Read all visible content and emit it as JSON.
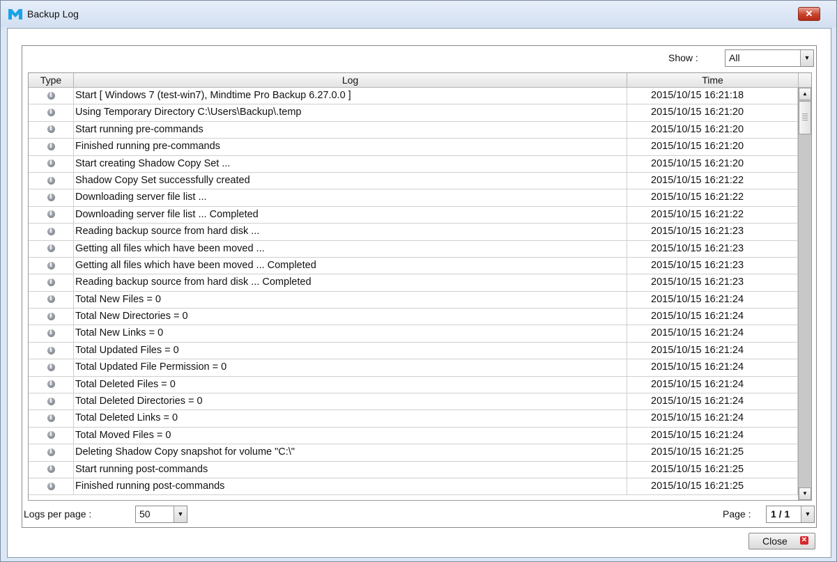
{
  "window": {
    "title": "Backup Log",
    "close_glyph": "✕",
    "logo_icon": "app-logo-icon"
  },
  "filter": {
    "show_label": "Show :",
    "show_value": "All"
  },
  "table": {
    "headers": {
      "type": "Type",
      "log": "Log",
      "time": "Time"
    },
    "rows": [
      {
        "type_icon": "info-icon",
        "log": "Start [ Windows 7 (test-win7), Mindtime Pro Backup 6.27.0.0 ]",
        "time": "2015/10/15 16:21:18"
      },
      {
        "type_icon": "info-icon",
        "log": "Using Temporary Directory C:\\Users\\Backup\\.temp",
        "time": "2015/10/15 16:21:20"
      },
      {
        "type_icon": "info-icon",
        "log": "Start running pre-commands",
        "time": "2015/10/15 16:21:20"
      },
      {
        "type_icon": "info-icon",
        "log": "Finished running pre-commands",
        "time": "2015/10/15 16:21:20"
      },
      {
        "type_icon": "info-icon",
        "log": "Start creating Shadow Copy Set ...",
        "time": "2015/10/15 16:21:20"
      },
      {
        "type_icon": "info-icon",
        "log": "Shadow Copy Set successfully created",
        "time": "2015/10/15 16:21:22"
      },
      {
        "type_icon": "info-icon",
        "log": "Downloading server file list ...",
        "time": "2015/10/15 16:21:22"
      },
      {
        "type_icon": "info-icon",
        "log": "Downloading server file list ... Completed",
        "time": "2015/10/15 16:21:22"
      },
      {
        "type_icon": "info-icon",
        "log": "Reading backup source from hard disk ...",
        "time": "2015/10/15 16:21:23"
      },
      {
        "type_icon": "info-icon",
        "log": "Getting all files which have been moved ...",
        "time": "2015/10/15 16:21:23"
      },
      {
        "type_icon": "info-icon",
        "log": "Getting all files which have been moved ... Completed",
        "time": "2015/10/15 16:21:23"
      },
      {
        "type_icon": "info-icon",
        "log": "Reading backup source from hard disk ... Completed",
        "time": "2015/10/15 16:21:23"
      },
      {
        "type_icon": "info-icon",
        "log": "Total New Files = 0",
        "time": "2015/10/15 16:21:24"
      },
      {
        "type_icon": "info-icon",
        "log": "Total New Directories = 0",
        "time": "2015/10/15 16:21:24"
      },
      {
        "type_icon": "info-icon",
        "log": "Total New Links = 0",
        "time": "2015/10/15 16:21:24"
      },
      {
        "type_icon": "info-icon",
        "log": "Total Updated Files = 0",
        "time": "2015/10/15 16:21:24"
      },
      {
        "type_icon": "info-icon",
        "log": "Total Updated File Permission = 0",
        "time": "2015/10/15 16:21:24"
      },
      {
        "type_icon": "info-icon",
        "log": "Total Deleted Files = 0",
        "time": "2015/10/15 16:21:24"
      },
      {
        "type_icon": "info-icon",
        "log": "Total Deleted Directories = 0",
        "time": "2015/10/15 16:21:24"
      },
      {
        "type_icon": "info-icon",
        "log": "Total Deleted Links = 0",
        "time": "2015/10/15 16:21:24"
      },
      {
        "type_icon": "info-icon",
        "log": "Total Moved Files = 0",
        "time": "2015/10/15 16:21:24"
      },
      {
        "type_icon": "info-icon",
        "log": "Deleting Shadow Copy snapshot for volume \"C:\\\"",
        "time": "2015/10/15 16:21:25"
      },
      {
        "type_icon": "info-icon",
        "log": "Start running post-commands",
        "time": "2015/10/15 16:21:25"
      },
      {
        "type_icon": "info-icon",
        "log": "Finished running post-commands",
        "time": "2015/10/15 16:21:25"
      }
    ]
  },
  "footer": {
    "logs_per_page_label": "Logs per page :",
    "logs_per_page_value": "50",
    "page_label": "Page :",
    "page_value": "1 / 1",
    "close_label": "Close",
    "close_icon_glyph": "✕"
  },
  "colors": {
    "title_bg": "#dbe7f5",
    "close_red": "#c7412b",
    "logo_blue": "#1aa3e8"
  }
}
